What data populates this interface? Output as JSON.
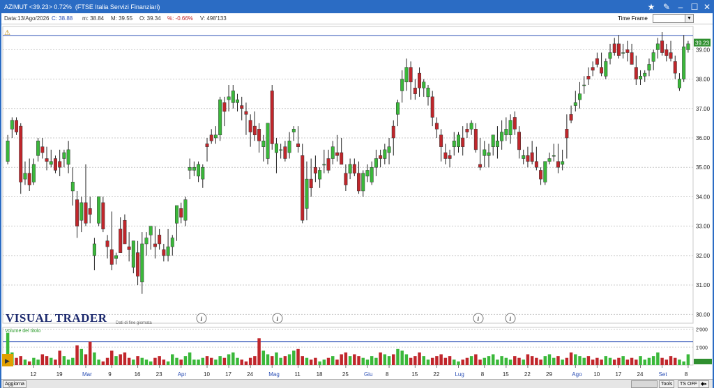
{
  "window": {
    "title": "AZIMUT <39.23> 0.72%  (FTSE Italia Servizi Finanziari)",
    "controls": [
      "★",
      "✎",
      "–",
      "☐",
      "✕"
    ]
  },
  "infobar": {
    "data": "Data:13/Ago/2026",
    "close": "C: 38.88",
    "min": "m: 38.84",
    "max": "M: 39.55",
    "open": "O: 39.34",
    "pct": "%: -0.66%",
    "volume": "V: 498'133",
    "time_frame_label": "Time Frame"
  },
  "branding": {
    "logo": "VISUAL TRADER",
    "subtitle": "Dati di fine giornata"
  },
  "volume_label": "Volume del titolo",
  "bottom": {
    "aggiorna": "Aggiorna",
    "tools": "Tools",
    "ts": "TS OFF"
  },
  "colors": {
    "up": "#3ab83a",
    "down": "#c0262b",
    "accent": "#2b6cc4"
  },
  "chart_data": {
    "type": "candlestick",
    "price_ylim": [
      29.7,
      39.6
    ],
    "price_ticks": [
      "39.00",
      "38.00",
      "37.00",
      "36.00",
      "35.00",
      "34.00",
      "33.00",
      "32.00",
      "31.00",
      "30.00"
    ],
    "last_price": "39.23",
    "volume_ticks": [
      "2'000",
      "1'000"
    ],
    "x_ticks": [
      "12",
      "19",
      "Mar",
      "9",
      "16",
      "23",
      "Apr",
      "10",
      "17",
      "24",
      "Mag",
      "11",
      "18",
      "25",
      "Giu",
      "8",
      "15",
      "22",
      "Lug",
      "8",
      "15",
      "22",
      "29",
      "Ago",
      "10",
      "17",
      "24",
      "Set",
      "8"
    ],
    "candles": [
      [
        35.2,
        36.1,
        35.1,
        35.9
      ],
      [
        36.3,
        36.7,
        36.0,
        36.6
      ],
      [
        36.6,
        36.7,
        36.1,
        36.2
      ],
      [
        36.4,
        36.5,
        34.1,
        34.5
      ],
      [
        34.6,
        35.2,
        34.4,
        34.8
      ],
      [
        34.8,
        35.3,
        34.2,
        34.4
      ],
      [
        34.5,
        35.3,
        34.4,
        35.1
      ],
      [
        35.4,
        36.0,
        35.2,
        35.9
      ],
      [
        35.7,
        36.0,
        35.3,
        35.5
      ],
      [
        35.3,
        35.7,
        34.9,
        35.2
      ],
      [
        35.1,
        35.6,
        35.0,
        35.2
      ],
      [
        35.3,
        35.4,
        34.8,
        34.9
      ],
      [
        35.2,
        35.6,
        34.7,
        35.0
      ],
      [
        35.3,
        35.6,
        35.0,
        35.5
      ],
      [
        35.1,
        35.9,
        34.8,
        35.6
      ],
      [
        34.2,
        35.0,
        33.7,
        34.5
      ],
      [
        33.9,
        34.2,
        32.6,
        33.0
      ],
      [
        33.2,
        34.0,
        32.8,
        33.8
      ],
      [
        33.8,
        35.1,
        33.0,
        33.1
      ],
      [
        33.6,
        34.0,
        33.1,
        33.4
      ],
      [
        32.0,
        32.6,
        31.5,
        32.4
      ],
      [
        33.1,
        34.0,
        33.0,
        34.0
      ],
      [
        33.8,
        34.0,
        32.8,
        32.9
      ],
      [
        32.5,
        32.7,
        31.9,
        32.3
      ],
      [
        32.2,
        33.5,
        31.5,
        31.7
      ],
      [
        31.9,
        32.1,
        31.7,
        32.0
      ],
      [
        32.9,
        33.3,
        32.1,
        32.1
      ],
      [
        33.2,
        33.4,
        32.4,
        32.4
      ],
      [
        32.3,
        32.8,
        31.8,
        32.2
      ],
      [
        31.6,
        32.4,
        31.4,
        32.5
      ],
      [
        32.1,
        32.5,
        31.0,
        31.3
      ],
      [
        31.1,
        32.8,
        30.7,
        32.4
      ],
      [
        32.4,
        32.8,
        32.0,
        32.6
      ],
      [
        32.7,
        33.0,
        32.2,
        33.0
      ],
      [
        32.4,
        33.0,
        31.9,
        32.3
      ],
      [
        32.7,
        32.9,
        32.2,
        32.4
      ],
      [
        32.2,
        32.4,
        31.8,
        32.0
      ],
      [
        32.0,
        32.9,
        31.8,
        32.3
      ],
      [
        32.3,
        32.7,
        32.0,
        32.6
      ],
      [
        33.1,
        33.4,
        32.5,
        33.7
      ],
      [
        33.6,
        33.8,
        33.1,
        33.3
      ],
      [
        33.2,
        34.0,
        33.0,
        33.9
      ],
      [
        34.9,
        35.3,
        34.6,
        35.0
      ],
      [
        34.9,
        35.2,
        34.7,
        35.0
      ],
      [
        34.7,
        35.2,
        34.5,
        35.1
      ],
      [
        34.6,
        35.1,
        34.3,
        35.0
      ],
      [
        35.8,
        36.0,
        35.2,
        35.7
      ],
      [
        36.1,
        36.3,
        35.8,
        35.9
      ],
      [
        36.0,
        36.4,
        35.8,
        36.1
      ],
      [
        36.1,
        37.4,
        35.9,
        37.3
      ],
      [
        37.2,
        37.4,
        36.4,
        36.9
      ],
      [
        37.3,
        37.8,
        36.9,
        37.4
      ],
      [
        37.2,
        37.8,
        37.0,
        37.6
      ],
      [
        37.2,
        37.5,
        36.9,
        37.3
      ],
      [
        37.1,
        37.4,
        36.6,
        37.0
      ],
      [
        36.9,
        37.2,
        36.1,
        36.8
      ],
      [
        36.6,
        36.8,
        35.7,
        36.2
      ],
      [
        36.4,
        36.9,
        35.9,
        36.1
      ],
      [
        36.3,
        36.5,
        35.5,
        35.9
      ],
      [
        35.7,
        36.1,
        35.2,
        35.9
      ],
      [
        35.3,
        36.5,
        35.1,
        36.5
      ],
      [
        37.6,
        37.8,
        35.6,
        35.8
      ],
      [
        35.5,
        36.0,
        34.8,
        35.8
      ],
      [
        35.6,
        35.8,
        35.3,
        35.6
      ],
      [
        35.7,
        35.9,
        35.2,
        35.3
      ],
      [
        35.5,
        36.2,
        35.3,
        35.9
      ],
      [
        36.2,
        36.4,
        35.9,
        36.3
      ],
      [
        35.8,
        36.4,
        35.5,
        35.7
      ],
      [
        35.4,
        35.8,
        33.1,
        33.2
      ],
      [
        33.6,
        35.2,
        33.2,
        34.6
      ],
      [
        34.6,
        35.3,
        34.0,
        34.3
      ],
      [
        35.0,
        35.4,
        34.5,
        34.8
      ],
      [
        34.6,
        35.0,
        34.3,
        34.9
      ],
      [
        35.1,
        35.6,
        34.8,
        35.1
      ],
      [
        35.3,
        35.6,
        34.8,
        34.9
      ],
      [
        35.3,
        35.9,
        35.1,
        35.7
      ],
      [
        35.5,
        36.1,
        35.2,
        35.4
      ],
      [
        35.5,
        36.0,
        35.1,
        35.1
      ],
      [
        34.8,
        35.1,
        34.2,
        34.4
      ],
      [
        34.8,
        35.3,
        34.6,
        35.1
      ],
      [
        35.1,
        35.3,
        34.7,
        34.8
      ],
      [
        34.8,
        35.2,
        34.1,
        34.2
      ],
      [
        34.2,
        34.9,
        34.0,
        34.8
      ],
      [
        34.7,
        35.1,
        34.5,
        34.9
      ],
      [
        34.5,
        35.2,
        34.4,
        35.0
      ],
      [
        35.0,
        35.6,
        34.7,
        35.3
      ],
      [
        35.4,
        35.6,
        35.0,
        35.3
      ],
      [
        35.3,
        35.8,
        35.1,
        35.6
      ],
      [
        35.5,
        36.0,
        35.1,
        35.7
      ],
      [
        36.4,
        36.6,
        35.4,
        36.0
      ],
      [
        36.8,
        37.3,
        36.4,
        37.2
      ],
      [
        37.6,
        38.3,
        37.2,
        38.0
      ],
      [
        37.9,
        38.7,
        37.6,
        38.4
      ],
      [
        38.4,
        38.6,
        37.3,
        37.9
      ],
      [
        37.7,
        38.0,
        37.3,
        37.5
      ],
      [
        38.2,
        38.4,
        37.4,
        37.7
      ],
      [
        37.7,
        38.0,
        37.4,
        37.9
      ],
      [
        37.4,
        37.8,
        37.1,
        37.7
      ],
      [
        37.4,
        37.6,
        36.4,
        36.7
      ],
      [
        36.5,
        36.7,
        36.0,
        36.3
      ],
      [
        36.1,
        36.3,
        35.2,
        35.7
      ],
      [
        35.5,
        35.8,
        35.1,
        35.3
      ],
      [
        35.4,
        35.6,
        35.0,
        35.3
      ],
      [
        35.7,
        36.2,
        35.4,
        35.9
      ],
      [
        35.7,
        36.2,
        35.5,
        36.1
      ],
      [
        36.0,
        36.4,
        35.4,
        35.7
      ],
      [
        36.3,
        36.5,
        36.0,
        36.2
      ],
      [
        36.3,
        36.6,
        36.1,
        36.5
      ],
      [
        36.3,
        36.5,
        35.5,
        35.6
      ],
      [
        35.1,
        36.0,
        34.9,
        35.0
      ],
      [
        35.4,
        35.9,
        35.0,
        35.6
      ],
      [
        35.4,
        35.8,
        35.0,
        35.5
      ],
      [
        35.7,
        36.1,
        35.4,
        36.1
      ],
      [
        35.7,
        36.4,
        35.3,
        35.9
      ],
      [
        35.9,
        36.6,
        35.6,
        36.2
      ],
      [
        36.1,
        36.7,
        35.9,
        36.3
      ],
      [
        36.1,
        36.8,
        35.8,
        36.6
      ],
      [
        36.7,
        36.9,
        36.1,
        36.3
      ],
      [
        36.2,
        36.4,
        35.3,
        35.6
      ],
      [
        35.3,
        35.6,
        35.1,
        35.4
      ],
      [
        35.4,
        35.7,
        35.0,
        35.2
      ],
      [
        35.5,
        35.9,
        35.1,
        35.2
      ],
      [
        35.2,
        35.7,
        34.9,
        35.0
      ],
      [
        34.9,
        35.0,
        34.4,
        34.6
      ],
      [
        34.5,
        35.1,
        34.4,
        35.2
      ],
      [
        35.2,
        35.5,
        35.1,
        35.3
      ],
      [
        35.4,
        35.8,
        35.2,
        35.4
      ],
      [
        35.2,
        35.8,
        34.8,
        35.0
      ],
      [
        35.1,
        35.6,
        34.9,
        35.2
      ],
      [
        36.3,
        36.8,
        35.3,
        36.0
      ],
      [
        36.8,
        37.1,
        36.5,
        36.6
      ],
      [
        37.1,
        37.6,
        36.9,
        37.2
      ],
      [
        37.3,
        37.9,
        37.0,
        37.5
      ],
      [
        37.8,
        38.1,
        37.5,
        37.8
      ],
      [
        38.1,
        38.4,
        37.8,
        38.0
      ],
      [
        38.4,
        38.6,
        38.1,
        38.3
      ],
      [
        38.7,
        38.9,
        38.4,
        38.5
      ],
      [
        38.4,
        38.9,
        38.1,
        38.2
      ],
      [
        38.1,
        38.7,
        38.0,
        38.6
      ],
      [
        38.7,
        39.2,
        38.5,
        38.9
      ],
      [
        39.2,
        39.4,
        38.8,
        38.9
      ],
      [
        39.2,
        39.5,
        38.7,
        38.8
      ],
      [
        38.9,
        39.2,
        38.7,
        38.9
      ],
      [
        39.0,
        39.3,
        38.6,
        38.9
      ],
      [
        38.9,
        39.2,
        38.5,
        38.5
      ],
      [
        38.4,
        38.8,
        37.8,
        38.0
      ],
      [
        38.0,
        38.3,
        37.8,
        38.1
      ],
      [
        38.1,
        38.3,
        37.9,
        38.2
      ],
      [
        38.3,
        38.7,
        38.1,
        38.5
      ],
      [
        38.6,
        39.0,
        38.3,
        38.9
      ],
      [
        39.0,
        39.4,
        38.7,
        39.2
      ],
      [
        39.3,
        39.6,
        38.8,
        38.9
      ],
      [
        39.0,
        39.2,
        38.6,
        38.8
      ],
      [
        38.9,
        39.3,
        38.6,
        38.7
      ],
      [
        38.6,
        38.8,
        38.0,
        38.2
      ],
      [
        37.7,
        38.2,
        37.6,
        38.0
      ],
      [
        38.0,
        39.5,
        37.9,
        39.1
      ],
      [
        39.0,
        39.3,
        38.9,
        39.2
      ]
    ],
    "volumes": [
      1800,
      700,
      400,
      500,
      300,
      200,
      400,
      300,
      600,
      500,
      400,
      300,
      800,
      500,
      300,
      400,
      1100,
      900,
      600,
      1300,
      700,
      300,
      200,
      400,
      800,
      500,
      600,
      700,
      400,
      300,
      500,
      400,
      300,
      200,
      400,
      500,
      300,
      200,
      600,
      400,
      300,
      500,
      700,
      300,
      300,
      400,
      500,
      400,
      300,
      500,
      400,
      600,
      700,
      400,
      300,
      200,
      400,
      500,
      1500,
      800,
      600,
      500,
      700,
      400,
      500,
      600,
      800,
      900,
      500,
      400,
      300,
      400,
      200,
      300,
      400,
      500,
      300,
      600,
      700,
      500,
      600,
      500,
      400,
      300,
      500,
      400,
      700,
      600,
      500,
      600,
      900,
      800,
      600,
      400,
      500,
      700,
      500,
      300,
      400,
      500,
      600,
      400,
      500,
      300,
      200,
      300,
      400,
      500,
      600,
      300,
      400,
      500,
      600,
      300,
      500,
      400,
      300,
      500,
      400,
      300,
      600,
      500,
      400,
      300,
      500,
      600,
      400,
      500,
      300,
      400,
      700,
      600,
      500,
      400,
      500,
      300,
      400,
      300,
      500,
      400,
      300,
      400,
      500,
      300,
      400,
      300,
      500,
      300,
      400,
      500,
      700,
      400,
      300,
      500,
      400,
      300,
      200,
      600
    ]
  }
}
